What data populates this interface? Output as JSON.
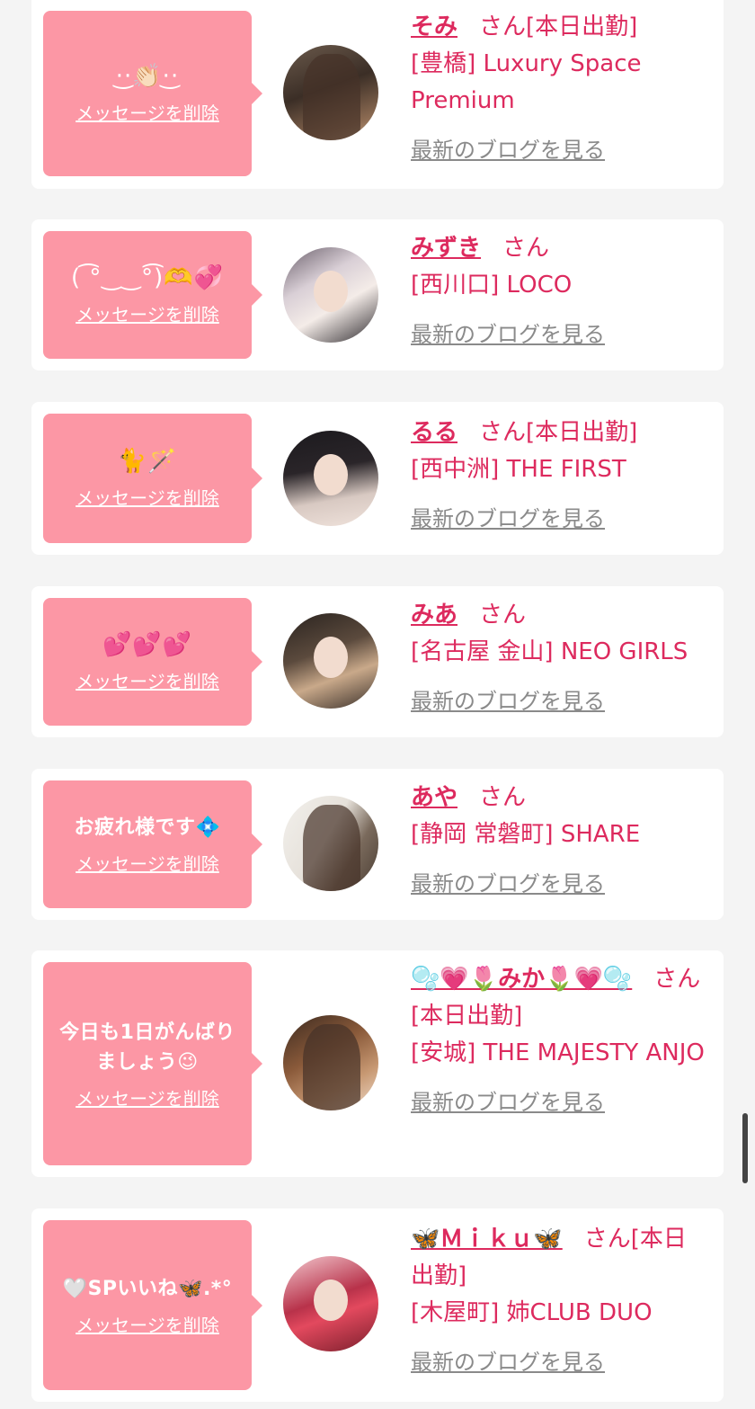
{
  "delete_label": "メッセージを削除",
  "blog_label": "最新のブログを見る",
  "san_suffix": "さん",
  "cards": [
    {
      "message": "·͜·👏🏻·͜·",
      "name": "そみ",
      "tail": "さん[本日出勤]",
      "shop": "[豊橋] Luxury Space Premium"
    },
    {
      "message": "( ͡°‿‿°͡)🫶💞",
      "name": "みずき",
      "tail": "さん",
      "shop": "[西川口] LOCO"
    },
    {
      "message": "🐈🪄",
      "name": "るる",
      "tail": "さん[本日出勤]",
      "shop": "[西中洲] THE FIRST"
    },
    {
      "message": "💕💕💕",
      "name": "みあ",
      "tail": "さん",
      "shop": "[名古屋 金山] NEO GIRLS"
    },
    {
      "message": "お疲れ様です💠",
      "name": "あや",
      "tail": "さん",
      "shop": "[静岡 常磐町] SHARE"
    },
    {
      "message": "今日も1日がんばりましょう😉",
      "name": "🫧💗🌷みか🌷💗🫧",
      "tail": "さん[本日出勤]",
      "shop": "[安城] THE MAJESTY ANJO"
    },
    {
      "message": "🤍SPいいね🦋.*°",
      "name": "🦋Ｍｉｋｕ🦋",
      "tail": "さん[本日出勤]",
      "shop": "[木屋町] 姉CLUB DUO"
    }
  ],
  "colors": {
    "page_bg": "#f4f4f4",
    "card_bg": "#ffffff",
    "bubble_bg": "#fc97a5",
    "name_pink": "#dd2a5e",
    "blog_gray": "#8a8a8a"
  },
  "icons": {
    "avatars": [
      "avatar-photo",
      "avatar-photo",
      "avatar-photo",
      "avatar-photo",
      "avatar-photo",
      "avatar-photo",
      "avatar-photo"
    ]
  }
}
